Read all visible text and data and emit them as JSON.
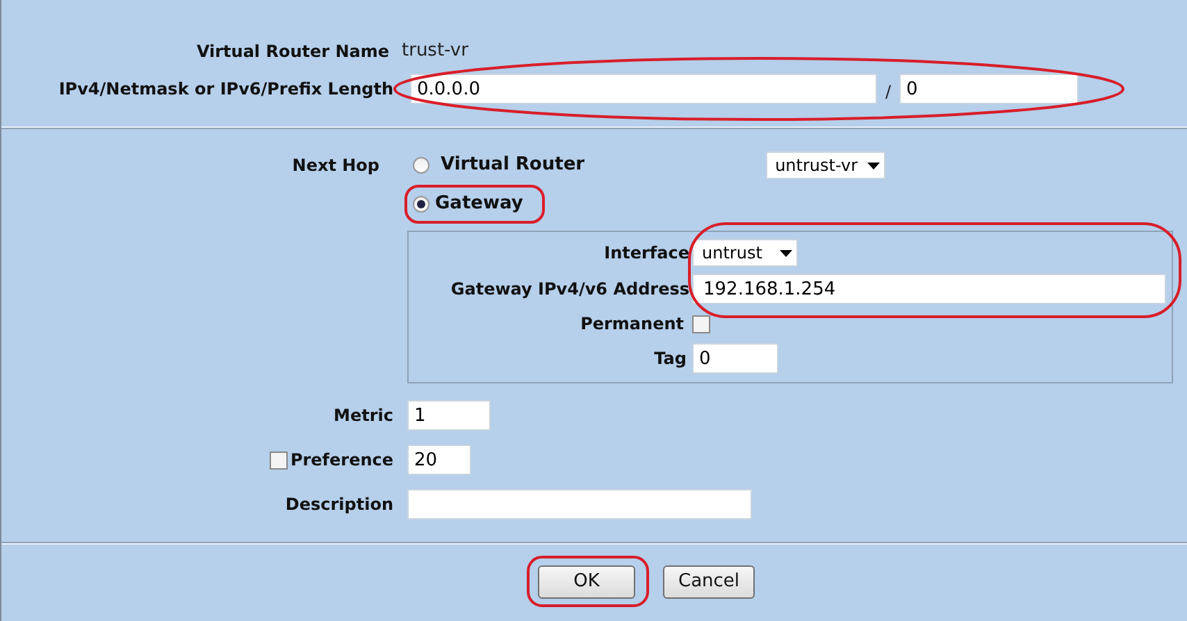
{
  "virtual_router_name": {
    "label": "Virtual Router Name",
    "value": "trust-vr"
  },
  "destination": {
    "label": "IPv4/Netmask or IPv6/Prefix Length",
    "address": "0.0.0.0",
    "separator": "/",
    "prefix": "0"
  },
  "next_hop": {
    "label": "Next Hop",
    "options": [
      {
        "label": "Virtual Router",
        "selected": false,
        "select_value": "untrust-vr"
      },
      {
        "label": "Gateway",
        "selected": true
      }
    ]
  },
  "gateway": {
    "interface": {
      "label": "Interface",
      "value": "untrust"
    },
    "address": {
      "label": "Gateway IPv4/v6 Address",
      "value": "192.168.1.254"
    },
    "permanent": {
      "label": "Permanent",
      "checked": false
    },
    "tag": {
      "label": "Tag",
      "value": "0"
    }
  },
  "metric": {
    "label": "Metric",
    "value": "1"
  },
  "preference": {
    "label": "Preference",
    "checked": false,
    "value": "20"
  },
  "description": {
    "label": "Description"
  },
  "buttons": [
    {
      "label": "OK"
    },
    {
      "label": "Cancel"
    }
  ]
}
